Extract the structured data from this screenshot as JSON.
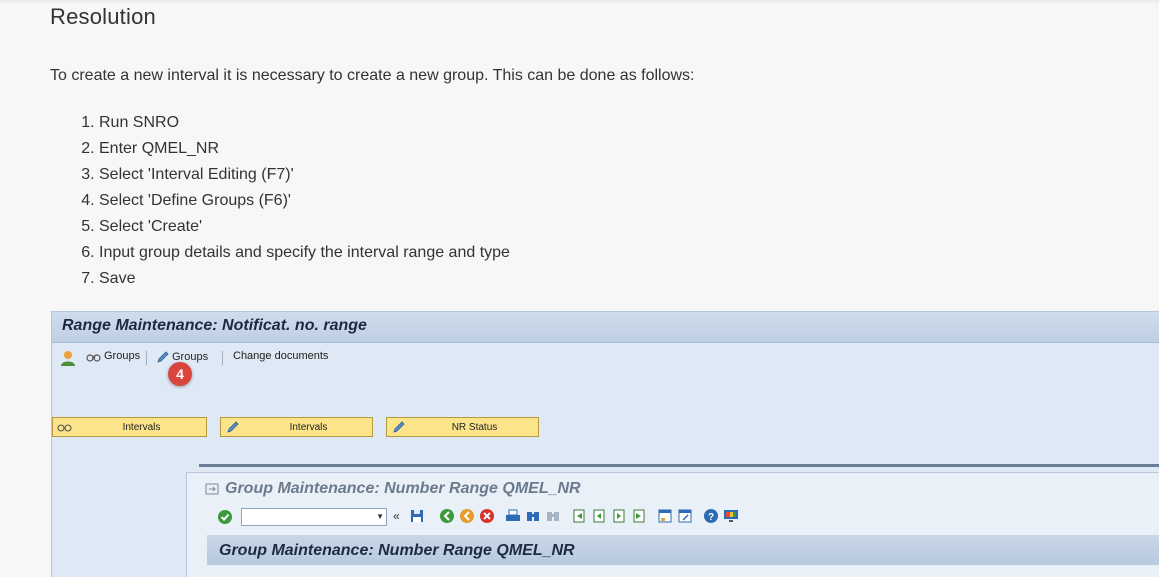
{
  "heading": "Resolution",
  "intro": "To create a new interval it is necessary to create a new group. This can be done as follows:",
  "steps": [
    "Run SNRO",
    "Enter QMEL_NR",
    "Select 'Interval Editing (F7)'",
    "Select 'Define Groups (F6)'",
    "Select 'Create'",
    "Input group details and specify the interval range and type",
    "Save"
  ],
  "sap": {
    "title": "Range Maintenance: Notificat. no. range",
    "toolbar": {
      "groups_display": "Groups",
      "groups_change": "Groups",
      "change_documents": "Change documents"
    },
    "callout_number": "4",
    "buttons": {
      "intervals_display": "Intervals",
      "intervals_change": "Intervals",
      "nr_status": "NR Status"
    },
    "dialog": {
      "title": "Group Maintenance: Number Range QMEL_NR",
      "subtitle": "Group Maintenance: Number Range QMEL_NR"
    }
  },
  "colors": {
    "sap_background": "#dfe9f5",
    "button_yellow": "#fbe48a",
    "callout_red": "#d9443c"
  }
}
